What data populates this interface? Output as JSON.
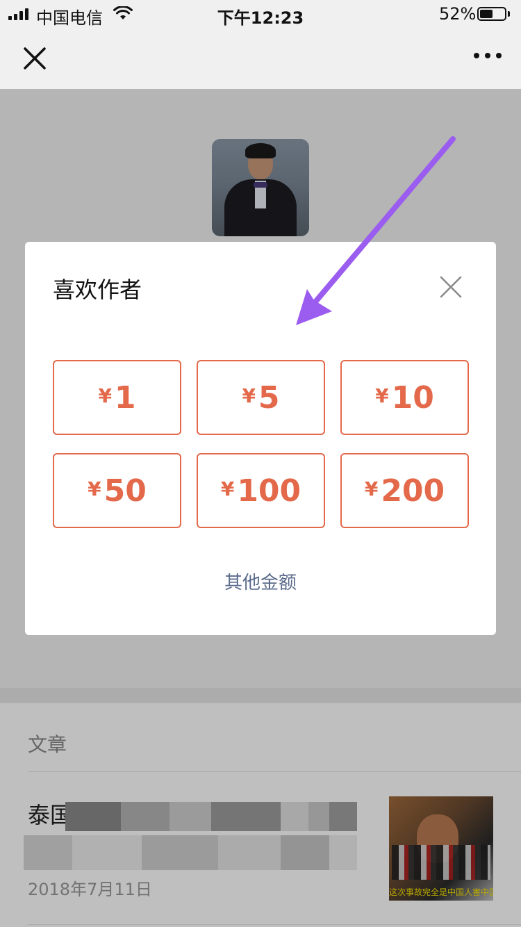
{
  "status_bar": {
    "carrier": "中国电信",
    "time": "下午12:23",
    "battery_percent": "52%",
    "battery_level": 0.52,
    "icons": [
      "signal-icon",
      "wifi-icon",
      "battery-icon"
    ]
  },
  "nav": {
    "icons": [
      "close-icon",
      "more-icon"
    ]
  },
  "reward_dialog": {
    "title": "喜欢作者",
    "currency_symbol": "¥",
    "amounts": [
      "1",
      "5",
      "10",
      "50",
      "100",
      "200"
    ],
    "other_amount": "其他金额",
    "accent_color": "#e4694a",
    "link_color": "#5b6b8c"
  },
  "articles": {
    "heading": "文章",
    "items": [
      {
        "title_visible_fragments": "泰国 布 都 己!",
        "date": "2018年7月11日",
        "thumbnail_caption": "这次事故完全是中国人害中国"
      }
    ]
  },
  "annotation": {
    "arrow_color": "#9b5cf0"
  }
}
